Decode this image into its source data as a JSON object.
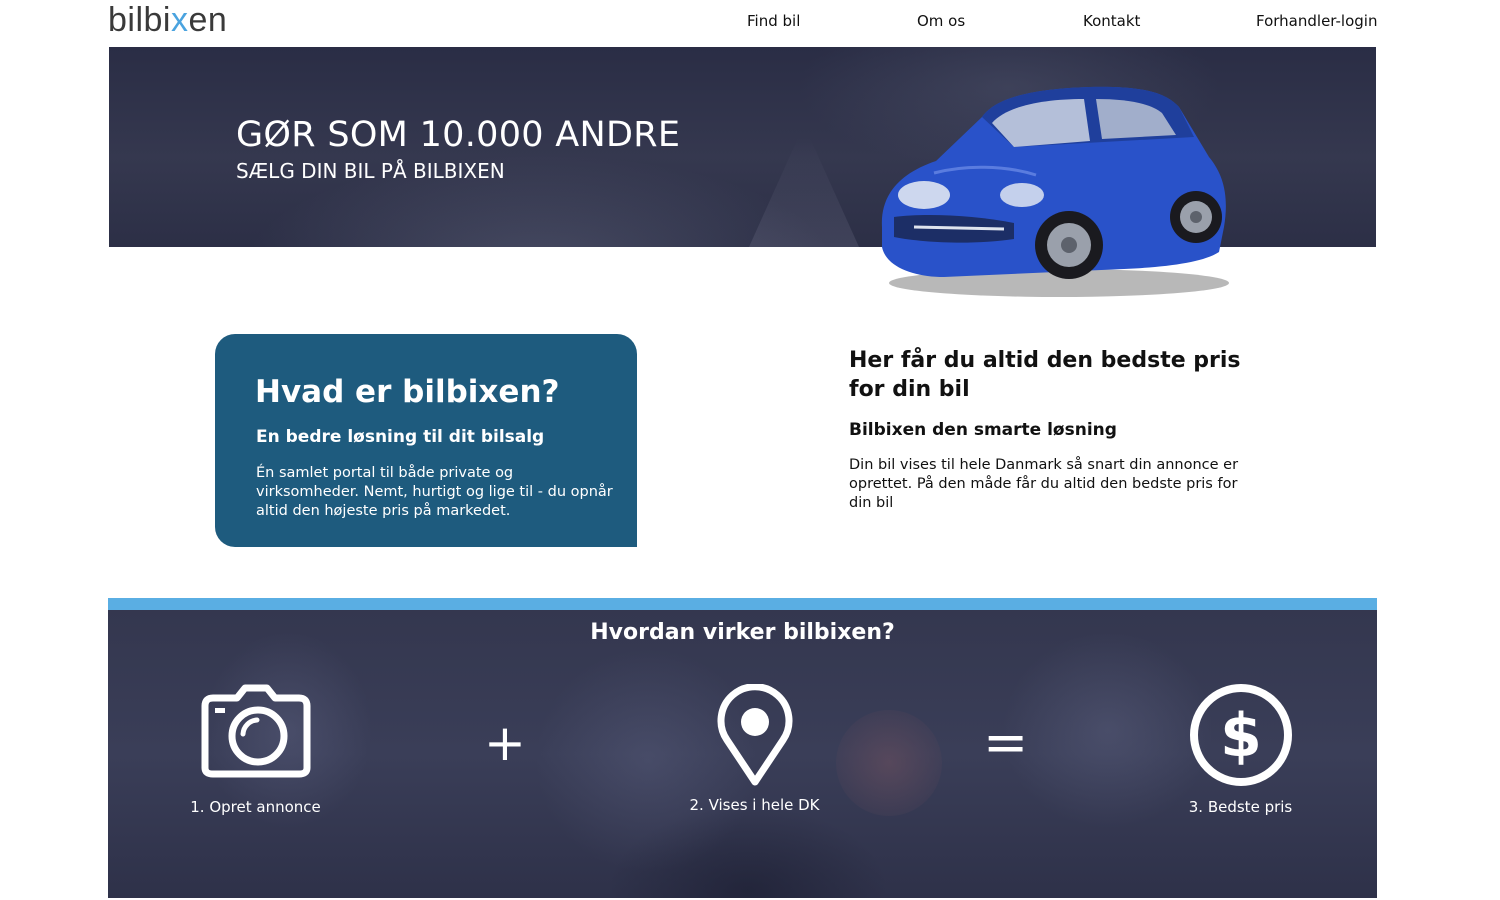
{
  "header": {
    "logo_pre": "bilbi",
    "logo_x": "x",
    "logo_post": "en",
    "nav": [
      {
        "label": "Find bil"
      },
      {
        "label": "Om os"
      },
      {
        "label": "Kontakt"
      },
      {
        "label": "Forhandler-login"
      }
    ]
  },
  "hero": {
    "title": "GØR SOM 10.000 ANDRE",
    "subtitle": "SÆLG DIN BIL PÅ BILBIXEN"
  },
  "about": {
    "heading": "Hvad er bilbixen?",
    "subheading": "En bedre løsning til dit bilsalg",
    "text": "Én samlet portal til både private og virksomheder. Nemt, hurtigt og lige til - du opnår altid den højeste pris på markedet."
  },
  "price": {
    "heading": "Her får du altid den bedste pris for din bil",
    "subheading": "Bilbixen den smarte løsning",
    "text": "Din bil vises til hele Danmark så snart din annonce er oprettet. På den måde får du altid den bedste pris for din bil"
  },
  "how": {
    "heading": "Hvordan virker bilbixen?",
    "steps": [
      {
        "label": "1. Opret annonce",
        "icon": "camera-icon"
      },
      {
        "label": "2. Vises i hele DK",
        "icon": "map-pin-icon"
      },
      {
        "label": "3. Bedste pris",
        "icon": "dollar-icon"
      }
    ],
    "plus": "+",
    "equals": "="
  },
  "colors": {
    "accent": "#5aaee3",
    "card": "#1e5b7e",
    "logo_x": "#4aa3df",
    "hero_bg": "#2e3149"
  }
}
